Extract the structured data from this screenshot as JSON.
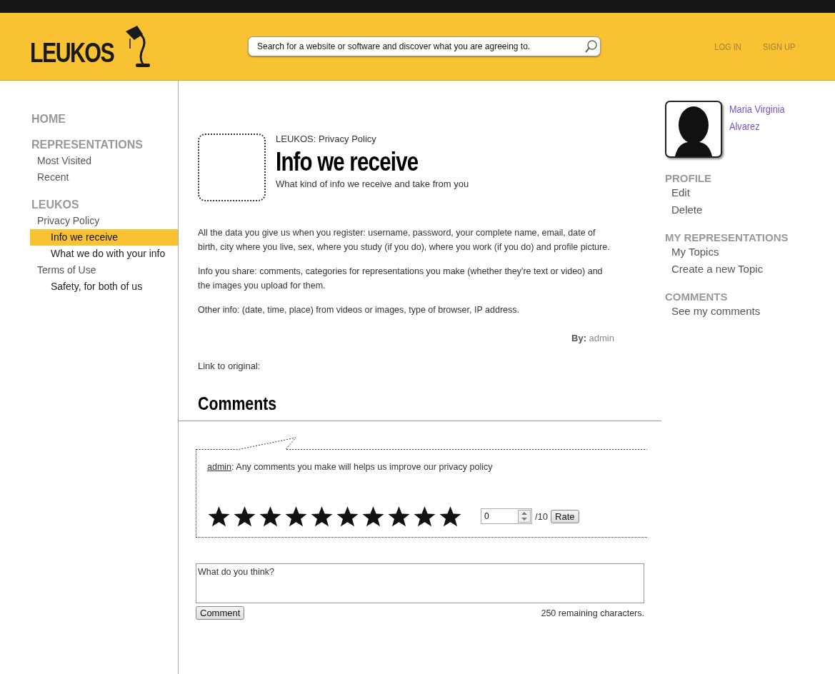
{
  "header": {
    "logo": "LEUKOS",
    "search": {
      "placeholder": "Search for a website or software and discover what you are agreeing to."
    },
    "links": [
      "LOG IN",
      "SIGN UP"
    ]
  },
  "sidebar": {
    "sections": [
      {
        "title": "HOME"
      },
      {
        "title": "REPRESENTATIONS",
        "items": [
          {
            "label": "Most Visited",
            "selected": false
          },
          {
            "label": "Recent",
            "selected": false
          }
        ]
      },
      {
        "title": "LEUKOS",
        "items": [
          {
            "label": "Privacy Policy",
            "selected": false,
            "children": [
              {
                "label": "Info we receive",
                "selected": true
              },
              {
                "label": "What we do with your info",
                "selected": false
              }
            ]
          },
          {
            "label": "Terms of Use",
            "selected": false,
            "children": [
              {
                "label": "Safety, for both of us",
                "selected": false
              }
            ]
          }
        ]
      }
    ]
  },
  "article": {
    "breadcrumb": "LEUKOS: Privacy Policy",
    "title": "Info we receive",
    "subtitle": "What kind of info we receive and take from you",
    "paragraphs": [
      "All the data you give us when you register: username, password, your complete name, email, date of birth, city where you live, sex, where you study (if you do), where you work (if you do) and profile picture.",
      "Info you share: comments, categories for representations you make (whether they're text or video) and the images you upload for them.",
      "Other info: (date, time, place) from videos or images, type of browser, IP address."
    ],
    "byline": {
      "label": "By:",
      "author": "admin"
    },
    "link_label": "Link to original:"
  },
  "comments": {
    "title": "Comments",
    "items": [
      {
        "author": "admin",
        "text": ": Any comments you make will helps us improve our privacy policy",
        "stars": 10,
        "rating_value": "0",
        "rating_max": "/10",
        "rate_button": "Rate"
      }
    ],
    "compose": {
      "value": "What do you think?",
      "button": "Comment",
      "remaining": "250 remaining characters."
    }
  },
  "profile": {
    "name": "Maria Virginia Alvarez",
    "sections": [
      {
        "title": "PROFILE",
        "items": [
          "Edit",
          "Delete"
        ]
      },
      {
        "title": "MY REPRESENTATIONS",
        "items": [
          "My Topics",
          "Create a new Topic"
        ]
      },
      {
        "title": "COMMENTS",
        "items": [
          "See my comments"
        ]
      }
    ]
  }
}
